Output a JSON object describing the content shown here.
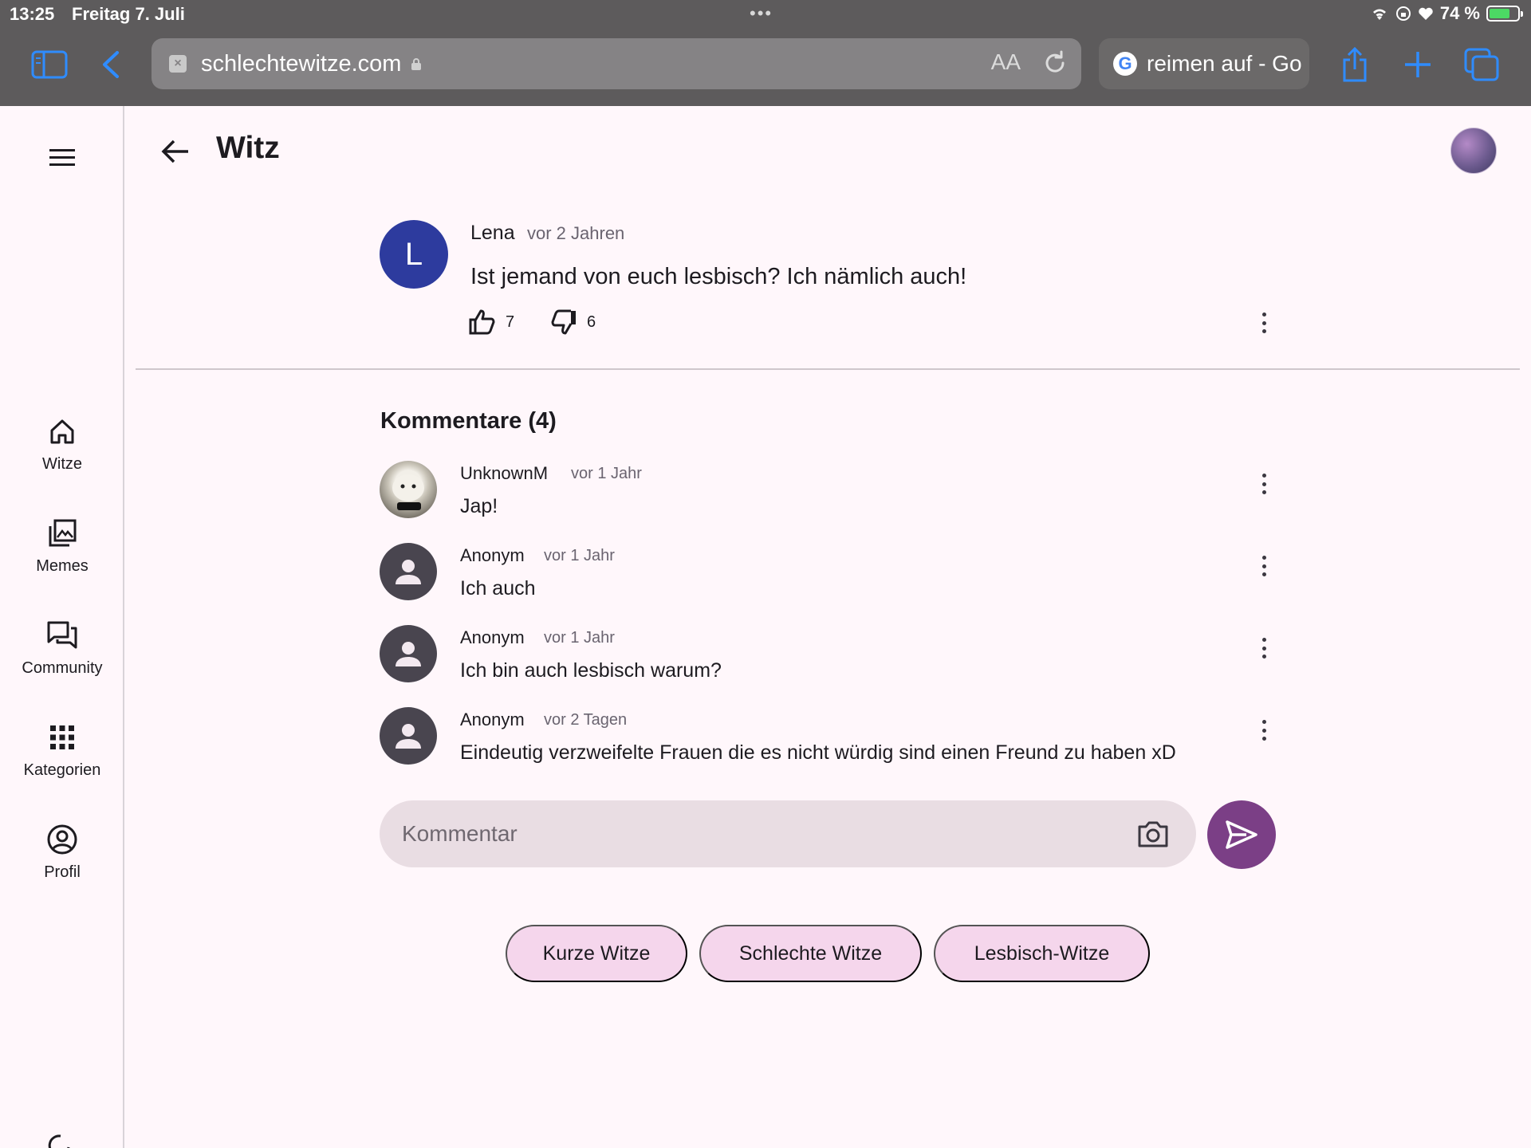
{
  "status_bar": {
    "time": "13:25",
    "date": "Freitag 7. Juli",
    "battery": "74 %",
    "battery_level": 0.74
  },
  "browser": {
    "url": "schlechtewitze.com",
    "reader_label": "AA",
    "tab_title": "reimen auf - Go",
    "tab_icon": "G"
  },
  "rail": {
    "items": [
      {
        "label": "Witze",
        "icon": "home-icon"
      },
      {
        "label": "Memes",
        "icon": "image-library-icon"
      },
      {
        "label": "Community",
        "icon": "forum-icon"
      },
      {
        "label": "Kategorien",
        "icon": "apps-grid-icon"
      },
      {
        "label": "Profil",
        "icon": "account-circle-icon"
      }
    ]
  },
  "header": {
    "title": "Witz"
  },
  "post": {
    "avatar_letter": "L",
    "author": "Lena",
    "time": "vor 2 Jahren",
    "text": "Ist jemand von euch lesbisch? Ich nämlich auch!",
    "likes": "7",
    "dislikes": "6"
  },
  "comments": {
    "title": "Kommentare (4)",
    "items": [
      {
        "author": "UnknownM",
        "time": "vor 1 Jahr",
        "text": "Jap!"
      },
      {
        "author": "Anonym",
        "time": "vor 1 Jahr",
        "text": "Ich auch"
      },
      {
        "author": "Anonym",
        "time": "vor 1 Jahr",
        "text": "Ich bin auch lesbisch warum?"
      },
      {
        "author": "Anonym",
        "time": "vor 2 Tagen",
        "text": "Eindeutig verzweifelte Frauen die es nicht würdig sind einen Freund zu haben xD"
      }
    ]
  },
  "comment_input": {
    "placeholder": "Kommentar"
  },
  "chips": [
    "Kurze Witze",
    "Schlechte Witze",
    "Lesbisch-Witze"
  ],
  "colors": {
    "accent": "#7b3f86",
    "chip": "#f5d6ec",
    "avatar_blue": "#2d3b9e",
    "background": "#fff7fb"
  }
}
